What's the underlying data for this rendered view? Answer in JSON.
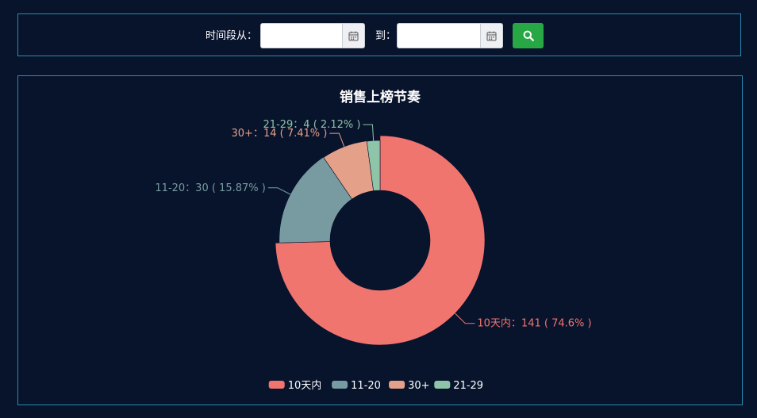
{
  "filter": {
    "from_label": "时间段从：",
    "to_label": "到：",
    "from_value": "",
    "to_value": "",
    "search_icon": "search-icon",
    "calendar_icon": "calendar-icon",
    "search_button_color": "#28a745"
  },
  "chart_data": {
    "type": "pie",
    "donut": true,
    "title": "销售上榜节奏",
    "legend_position": "bottom-center",
    "slices": [
      {
        "name": "10天内",
        "value": 141,
        "percent": 74.6,
        "label": "10天内：141 ( 74.6% )",
        "color": "#f0756f"
      },
      {
        "name": "11-20",
        "value": 30,
        "percent": 15.87,
        "label": "11-20：30 ( 15.87% )",
        "color": "#789ba1"
      },
      {
        "name": "30+",
        "value": 14,
        "percent": 7.41,
        "label": "30+：14 ( 7.41% )",
        "color": "#e5a08a"
      },
      {
        "name": "21-29",
        "value": 4,
        "percent": 2.12,
        "label": "21-29：4 ( 2.12% )",
        "color": "#8ec5a8"
      }
    ]
  }
}
